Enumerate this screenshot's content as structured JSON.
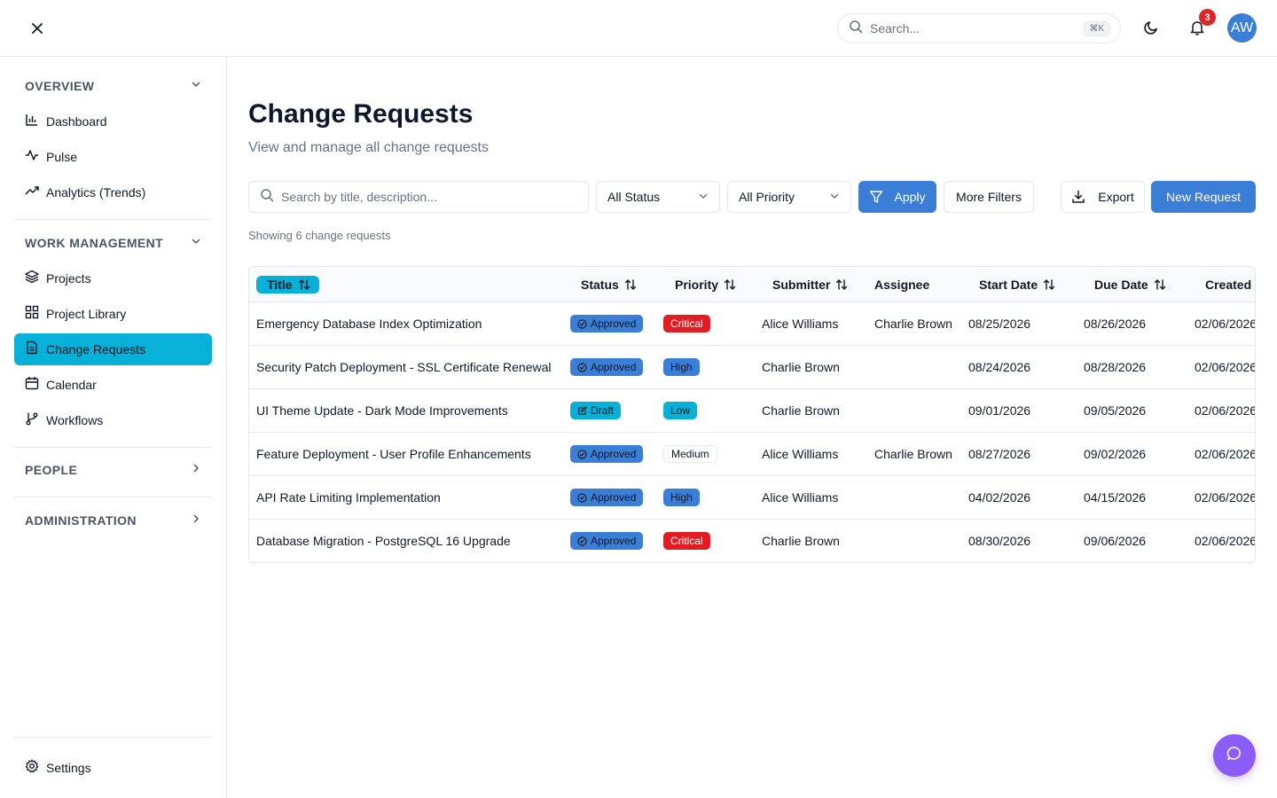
{
  "header": {
    "search_placeholder": "Search...",
    "search_shortcut": "⌘K",
    "notification_count": "3",
    "avatar_initials": "AW"
  },
  "sidebar": {
    "sections": {
      "overview": "OVERVIEW",
      "work_management": "WORK MANAGEMENT",
      "people": "PEOPLE",
      "administration": "ADMINISTRATION"
    },
    "items": {
      "dashboard": "Dashboard",
      "pulse": "Pulse",
      "analytics": "Analytics (Trends)",
      "projects": "Projects",
      "project_library": "Project Library",
      "change_requests": "Change Requests",
      "calendar": "Calendar",
      "workflows": "Workflows",
      "settings": "Settings"
    }
  },
  "main": {
    "title": "Change Requests",
    "subtitle": "View and manage all change requests",
    "search_placeholder": "Search by title, description...",
    "status_filter": "All Status",
    "priority_filter": "All Priority",
    "apply_label": "Apply",
    "more_filters_label": "More Filters",
    "export_label": "Export",
    "new_request_label": "New Request",
    "showing_text": "Showing 6 change requests"
  },
  "table": {
    "columns": {
      "title": "Title",
      "status": "Status",
      "priority": "Priority",
      "submitter": "Submitter",
      "assignee": "Assignee",
      "start_date": "Start Date",
      "due_date": "Due Date",
      "created": "Created"
    },
    "rows": [
      {
        "title": "Emergency Database Index Optimization",
        "status": "Approved",
        "priority": "Critical",
        "submitter": "Alice Williams",
        "assignee": "Charlie Brown",
        "start_date": "08/25/2026",
        "due_date": "08/26/2026",
        "created": "02/06/2026"
      },
      {
        "title": "Security Patch Deployment - SSL Certificate Renewal",
        "status": "Approved",
        "priority": "High",
        "submitter": "Charlie Brown",
        "assignee": "",
        "start_date": "08/24/2026",
        "due_date": "08/28/2026",
        "created": "02/06/2026"
      },
      {
        "title": "UI Theme Update - Dark Mode Improvements",
        "status": "Draft",
        "priority": "Low",
        "submitter": "Charlie Brown",
        "assignee": "",
        "start_date": "09/01/2026",
        "due_date": "09/05/2026",
        "created": "02/06/2026"
      },
      {
        "title": "Feature Deployment - User Profile Enhancements",
        "status": "Approved",
        "priority": "Medium",
        "submitter": "Alice Williams",
        "assignee": "Charlie Brown",
        "start_date": "08/27/2026",
        "due_date": "09/02/2026",
        "created": "02/06/2026"
      },
      {
        "title": "API Rate Limiting Implementation",
        "status": "Approved",
        "priority": "High",
        "submitter": "Alice Williams",
        "assignee": "",
        "start_date": "04/02/2026",
        "due_date": "04/15/2026",
        "created": "02/06/2026"
      },
      {
        "title": "Database Migration - PostgreSQL 16 Upgrade",
        "status": "Approved",
        "priority": "Critical",
        "submitter": "Charlie Brown",
        "assignee": "",
        "start_date": "08/30/2026",
        "due_date": "09/06/2026",
        "created": "02/06/2026"
      }
    ]
  },
  "colors": {
    "accent_cyan": "#06b0d6",
    "primary_blue": "#3b7ed6",
    "critical_red": "#e11d24",
    "chat_purple": "#8b5cf6",
    "notification_red": "#dc2626"
  },
  "icons": {
    "close": "close-icon",
    "search": "search-icon",
    "theme": "moon-icon",
    "notifications": "bell-icon",
    "chat": "chat-bubble-icon"
  }
}
